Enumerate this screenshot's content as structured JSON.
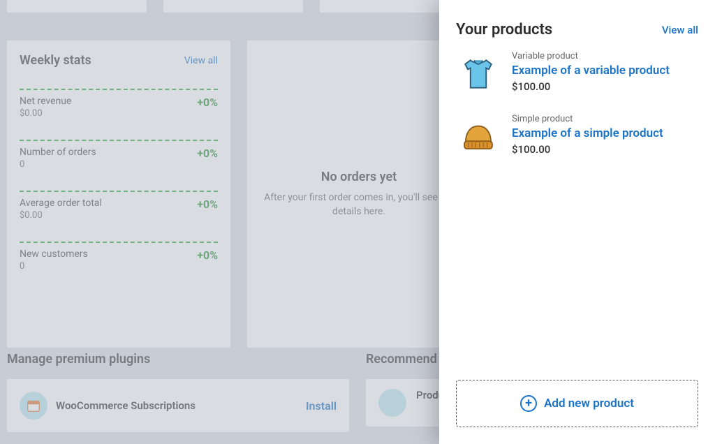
{
  "weekly_stats": {
    "title": "Weekly stats",
    "view_all": "View all",
    "items": [
      {
        "label": "Net revenue",
        "value": "$0.00",
        "pct": "+0%"
      },
      {
        "label": "Number of orders",
        "value": "0",
        "pct": "+0%"
      },
      {
        "label": "Average order total",
        "value": "$0.00",
        "pct": "+0%"
      },
      {
        "label": "New customers",
        "value": "0",
        "pct": "+0%"
      }
    ]
  },
  "orders_empty": {
    "title": "No orders yet",
    "desc": "After your first order comes in, you'll see the details here."
  },
  "manage_plugins": {
    "title": "Manage premium plugins",
    "plugin_name": "WooCommerce Subscriptions",
    "install": "Install"
  },
  "recommended": {
    "title": "Recommend",
    "item_title": "Product Vendors"
  },
  "your_products": {
    "title": "Your products",
    "view_all": "View all",
    "items": [
      {
        "type": "Variable product",
        "title": "Example of a variable product",
        "price": "$100.00",
        "thumb": "shirt"
      },
      {
        "type": "Simple product",
        "title": "Example of a simple product",
        "price": "$100.00",
        "thumb": "beanie"
      }
    ],
    "add_label": "Add new product"
  }
}
